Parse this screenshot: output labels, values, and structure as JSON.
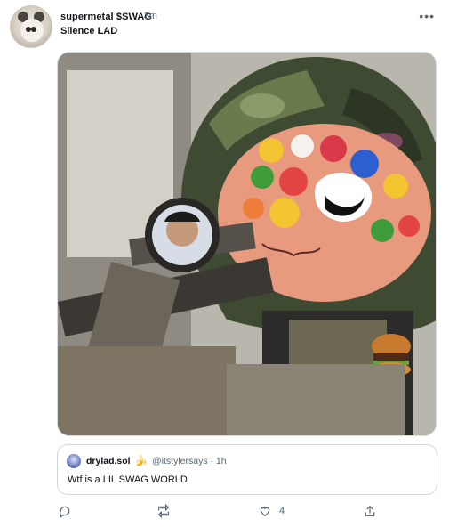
{
  "header": {
    "display_name": "supermetal $SWAG",
    "handle_time": "·3m",
    "avatar": "cat-avatar",
    "more_icon": "more-horizontal-icon"
  },
  "post": {
    "text": "Silence LAD"
  },
  "media": {
    "description": "photo-media"
  },
  "quote": {
    "name": "drylad.sol",
    "emoji": "🍌",
    "handle_time": "@itstylersays · 1h",
    "text": "Wtf is a LIL SWAG WORLD"
  },
  "actions": {
    "reply_icon": "reply-icon",
    "retweet_icon": "retweet-icon",
    "like_icon": "heart-icon",
    "like_count": "4",
    "share_icon": "share-icon"
  }
}
